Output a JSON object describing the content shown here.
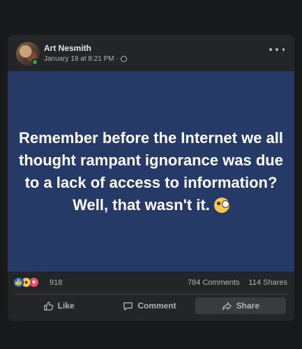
{
  "post": {
    "author": "Art Nesmith",
    "timestamp": "January 19 at 8:21 PM",
    "separator": "·",
    "privacy_icon": "globe-icon",
    "body_text": "Remember before the Internet we all thought rampant ignorance was due to a lack of access to information? Well, that wasn't it.",
    "body_emoji": "face-with-monocle",
    "background_color": "#253a66"
  },
  "reactions": {
    "types": [
      "like",
      "haha",
      "love"
    ],
    "count": "918"
  },
  "stats": {
    "comments": "784 Comments",
    "shares": "114 Shares"
  },
  "actions": {
    "like_label": "Like",
    "comment_label": "Comment",
    "share_label": "Share"
  }
}
